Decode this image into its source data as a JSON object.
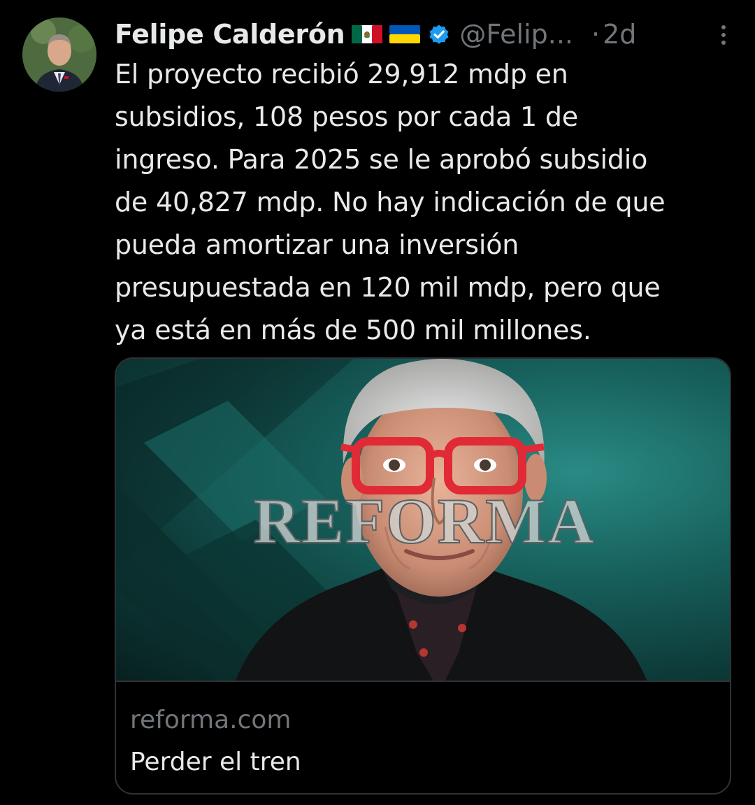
{
  "author": {
    "name": "Felipe Calderón",
    "handle": "@Felip...",
    "separator": "·",
    "time": "2d"
  },
  "tweet": {
    "text": "El proyecto recibió 29,912 mdp en\nsubsidios, 108 pesos por cada 1 de\ningreso. Para 2025 se le aprobó subsidio\nde 40,827 mdp. No hay indicación de que\npueda amortizar una inversión\npresupuestada en 120 mil mdp, pero que\nya está en más de 500 mil millones."
  },
  "card": {
    "watermark": "REFORMA",
    "domain": "reforma.com",
    "title": "Perder el tren"
  },
  "icons": {
    "flags": [
      "mexico-flag-icon",
      "ukraine-flag-icon"
    ],
    "verified": "verified-badge-icon",
    "more": "more-options-icon"
  },
  "colors": {
    "background": "#000000",
    "text": "#e7e9ea",
    "muted": "#71767b",
    "border": "#2f3336",
    "verified": "#1d9bf0",
    "card_bg": "#17605c",
    "glasses": "#e02a35"
  }
}
